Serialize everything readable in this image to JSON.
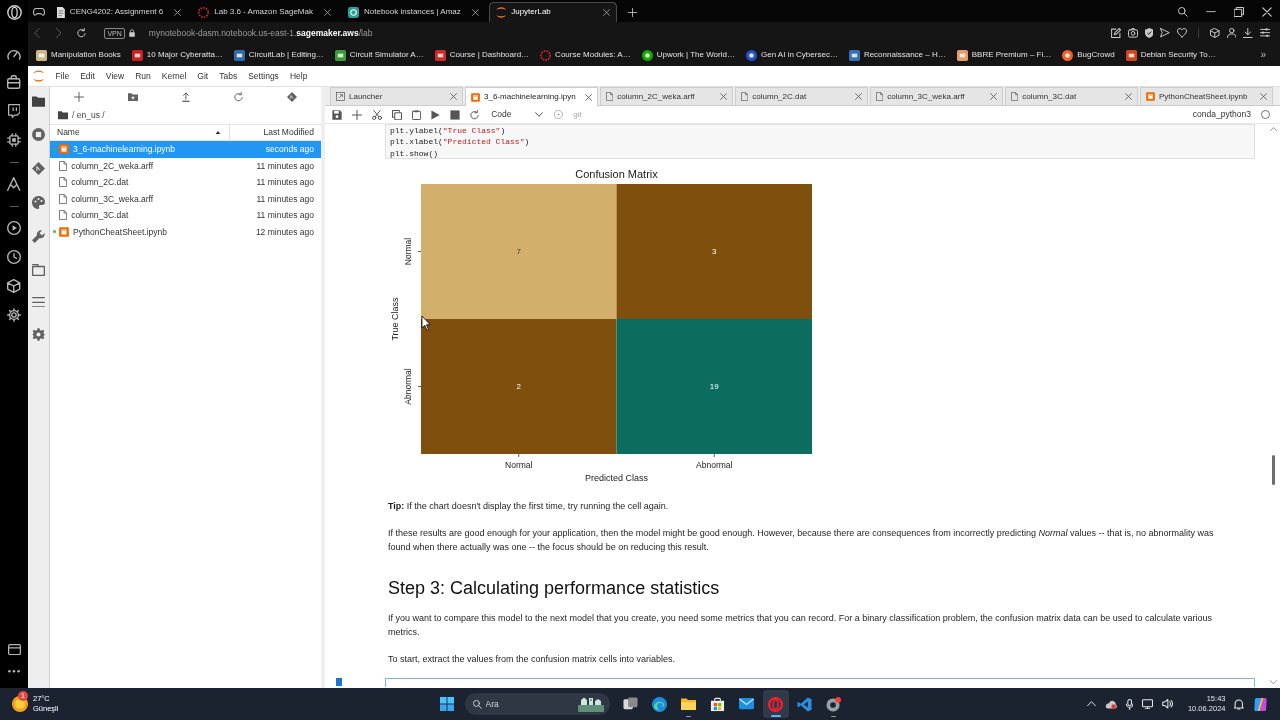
{
  "browser": {
    "tabs": [
      {
        "title": "CENG4202: Assignment 6",
        "selected": false
      },
      {
        "title": "Lab 3.6 - Amazon SageMak",
        "selected": false
      },
      {
        "title": "Notebook instances | Amaz",
        "selected": false
      },
      {
        "title": "JupyterLab",
        "selected": true
      }
    ],
    "vpn_badge": "VPN",
    "url": "mynotebook-dasm.notebook.us-east-1.**sagemaker.aws**/lab",
    "bookmarks": [
      "Manipulation Books",
      "10 Major Cyberatta…",
      "CircuitLab | Editing…",
      "Circuit Simulator A…",
      "Course | Dashboard…",
      "Course Modules: A…",
      "Upwork | The World…",
      "Gen AI in Cybersec…",
      "Reconnaissance – H…",
      "BBRE Premium – Fi…",
      "BugCrowd",
      "Debian Security To…"
    ],
    "bookmarks_overflow": "»"
  },
  "jupyter": {
    "menu": [
      "File",
      "Edit",
      "View",
      "Run",
      "Kernel",
      "Git",
      "Tabs",
      "Settings",
      "Help"
    ],
    "file_browser": {
      "path": "/ en_us /",
      "columns": [
        "Name",
        "Last Modified"
      ],
      "files": [
        {
          "name": "3_6-machinelearning.ipynb",
          "modified": "seconds ago",
          "kind": "notebook",
          "selected": true,
          "running": true
        },
        {
          "name": "column_2C_weka.arff",
          "modified": "11 minutes ago",
          "kind": "file",
          "selected": false,
          "running": false
        },
        {
          "name": "column_2C.dat",
          "modified": "11 minutes ago",
          "kind": "file",
          "selected": false,
          "running": false
        },
        {
          "name": "column_3C_weka.arff",
          "modified": "11 minutes ago",
          "kind": "file",
          "selected": false,
          "running": false
        },
        {
          "name": "column_3C.dat",
          "modified": "11 minutes ago",
          "kind": "file",
          "selected": false,
          "running": false
        },
        {
          "name": "PythonCheatSheet.ipynb",
          "modified": "12 minutes ago",
          "kind": "notebook",
          "selected": false,
          "running": true
        }
      ]
    },
    "tabs": [
      {
        "label": "Launcher",
        "kind": "launcher",
        "selected": false
      },
      {
        "label": "3_6-machinelearning.ipyn",
        "kind": "notebook",
        "selected": true
      },
      {
        "label": "column_2C_weka.arff",
        "kind": "file",
        "selected": false
      },
      {
        "label": "column_2C.dat",
        "kind": "file",
        "selected": false
      },
      {
        "label": "column_3C_weka.arff",
        "kind": "file",
        "selected": false
      },
      {
        "label": "column_3C.dat",
        "kind": "file",
        "selected": false
      },
      {
        "label": "PythonCheatSheet.ipynb",
        "kind": "notebook",
        "selected": false
      }
    ],
    "toolbar": {
      "cell_type": "Code",
      "git_label": "git",
      "kernel": "conda_python3"
    },
    "code_cell": {
      "lines": [
        {
          "tokens": [
            {
              "text": "plt.ylabel(",
              "kind": "plain"
            },
            {
              "text": "\"True Class\"",
              "kind": "string"
            },
            {
              "text": ")",
              "kind": "plain"
            }
          ]
        },
        {
          "tokens": [
            {
              "text": "plt.xlabel(",
              "kind": "plain"
            },
            {
              "text": "\"Predicted Class\"",
              "kind": "string"
            },
            {
              "text": ")",
              "kind": "plain"
            }
          ]
        },
        {
          "tokens": [
            {
              "text": "plt.show()",
              "kind": "plain"
            }
          ]
        }
      ]
    },
    "confusion_matrix": {
      "title": "Confusion Matrix",
      "ylabel": "True Class",
      "y_categories": [
        "Normal",
        "Abnormal"
      ],
      "cell_rows": [
        [
          {
            "value": "7",
            "color": "#d2b06b"
          },
          {
            "value": "3",
            "color": "#7e4f0d"
          }
        ],
        [
          {
            "value": "2",
            "color": "#7e4f0d"
          },
          {
            "value": "19",
            "color": "#0c6c5d"
          }
        ]
      ],
      "x_categories": [
        "Normal",
        "Abnormal"
      ],
      "xlabel": "Predicted Class"
    },
    "markdown": [
      {
        "kind": "paragraph",
        "text": "**Tip:** If the chart doesn't display the first time, try running the cell again."
      },
      {
        "kind": "paragraph",
        "text": "If these results are good enough for your application, then the model might be good enough. However, because there are consequences from incorrectly predicting *Normal* values -- that is, no abnormality was found when there actually was one -- the focus should be on reducing this result."
      },
      {
        "kind": "heading",
        "text": "Step 3: Calculating performance statistics"
      },
      {
        "kind": "paragraph",
        "text": "If you want to compare this model to the next model that you create, you need some metrics that you can record. For a binary classification problem, the confusion matrix data can be used to calculate various metrics."
      },
      {
        "kind": "paragraph",
        "text": "To start, extract the values from the confusion matrix cells into variables."
      }
    ],
    "next_cell": {
      "active": true
    }
  },
  "taskbar": {
    "weather": {
      "badge": "1",
      "temperature": "27°C",
      "condition": "Güneşli"
    },
    "search": {
      "placeholder": "Ara"
    },
    "apps": [
      {
        "selected": false,
        "running": false
      },
      {
        "selected": false,
        "running": false
      },
      {
        "selected": false,
        "running": true
      },
      {
        "selected": false,
        "running": false
      },
      {
        "selected": false,
        "running": false
      },
      {
        "selected": true,
        "running": true
      },
      {
        "selected": false,
        "running": false
      },
      {
        "selected": false,
        "running": true
      }
    ],
    "clock": {
      "time": "15:43",
      "date": "10.06.2024"
    }
  }
}
